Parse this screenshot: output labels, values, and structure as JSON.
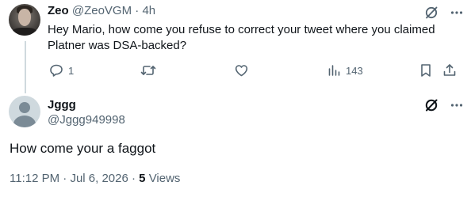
{
  "reply_to": {
    "author_name": "Zeo",
    "author_handle": "@ZeoVGM",
    "separator": "·",
    "timestamp": "4h",
    "text": "Hey Mario, how come you refuse to correct your tweet where you claimed Platner was DSA-backed?",
    "avatar_icon": "profile-photo",
    "actions": {
      "replies": "1",
      "reposts": "",
      "likes": "",
      "views": "143"
    }
  },
  "main_tweet": {
    "author_name": "Jggg",
    "author_handle": "@Jggg949998",
    "avatar_icon": "default-avatar",
    "text": "How come your a faggot",
    "time": "11:12 PM",
    "date": "Jul 6, 2026",
    "separator": "·",
    "views_count": "5",
    "views_label": "Views"
  },
  "colors": {
    "text": "#0f1419",
    "muted": "#536471",
    "thread_line": "#cfd9de"
  }
}
